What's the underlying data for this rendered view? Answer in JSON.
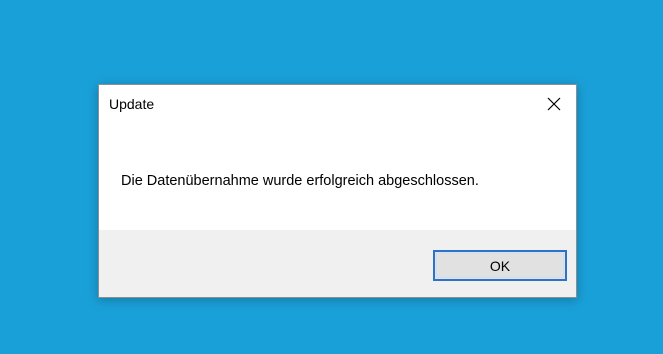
{
  "desktop": {
    "background_color": "#1aa0d8"
  },
  "dialog": {
    "title": "Update",
    "close_icon": "close-icon",
    "message": "Die Datenübernahme wurde erfolgreich abgeschlossen.",
    "ok_label": "OK",
    "accent_color": "#2b73c8"
  }
}
